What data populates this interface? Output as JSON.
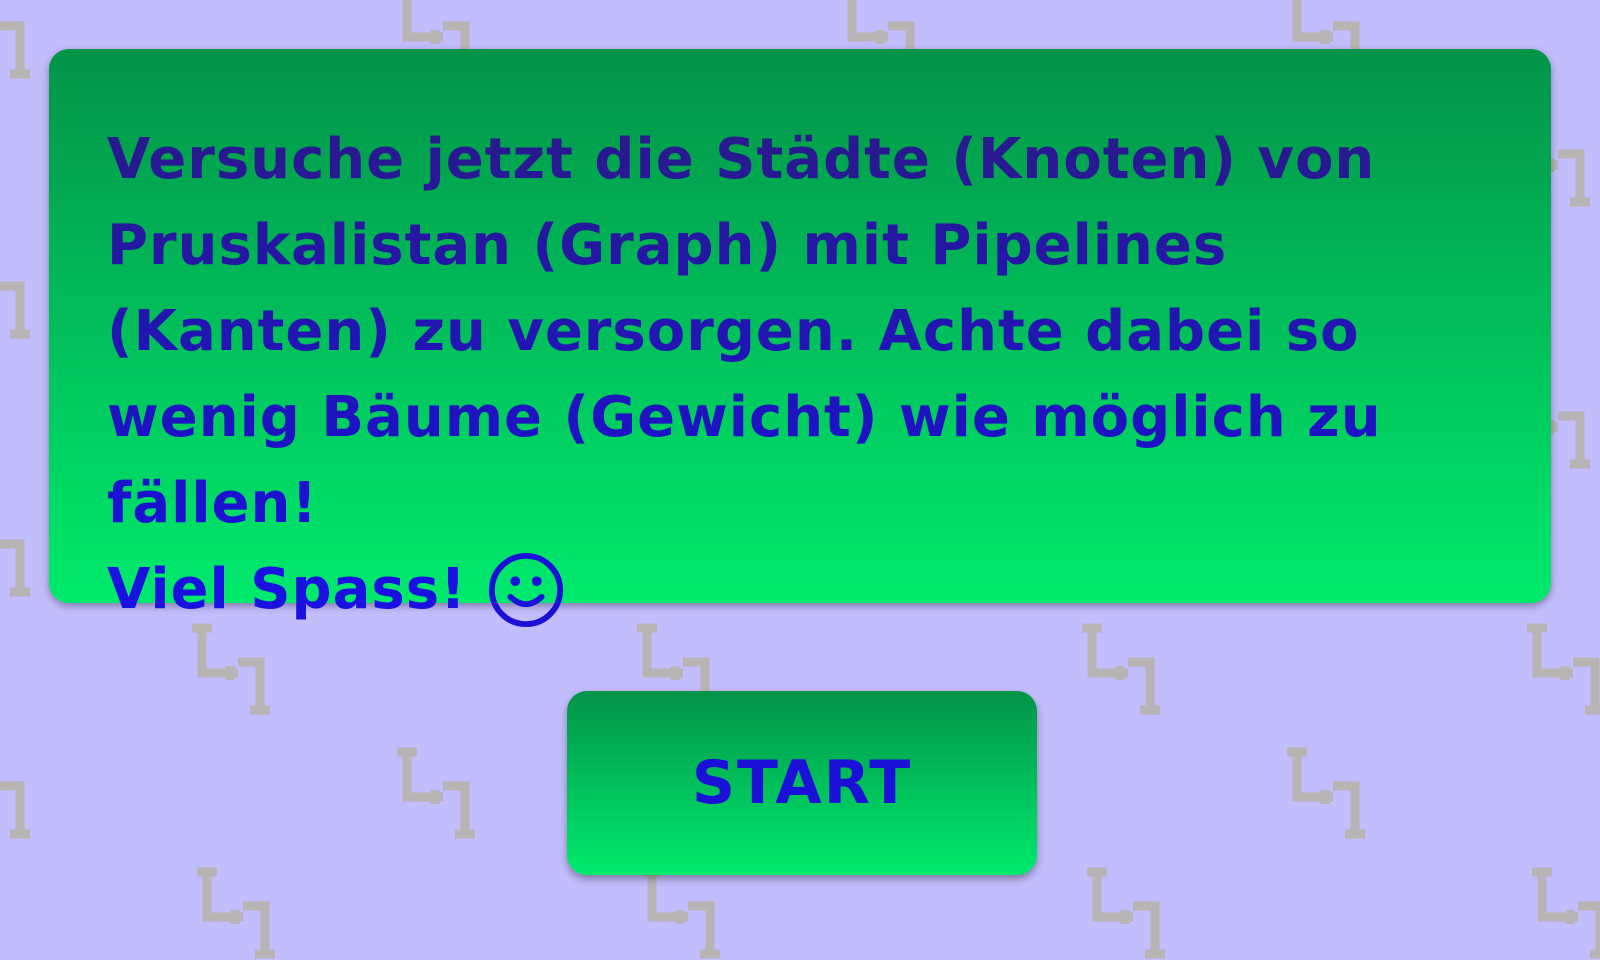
{
  "intro": {
    "text": "Versuche jetzt die Städte (Knoten) von Pruskalistan (Graph) mit Pipelines (Kanten) zu versorgen. Achte dabei so wenig Bäume (Gewicht) wie möglich zu fällen!",
    "closing": "Viel Spass!",
    "closing_icon": "smiley-icon"
  },
  "start_button": {
    "label": "START"
  },
  "colors": {
    "background": "#c2bdfd",
    "panel_top": "#029348",
    "panel_bottom": "#00ea6d",
    "text": "#1a10d8",
    "pipe_pattern": "#b8b4b4"
  },
  "background_pattern_icon": "pipe-icon"
}
